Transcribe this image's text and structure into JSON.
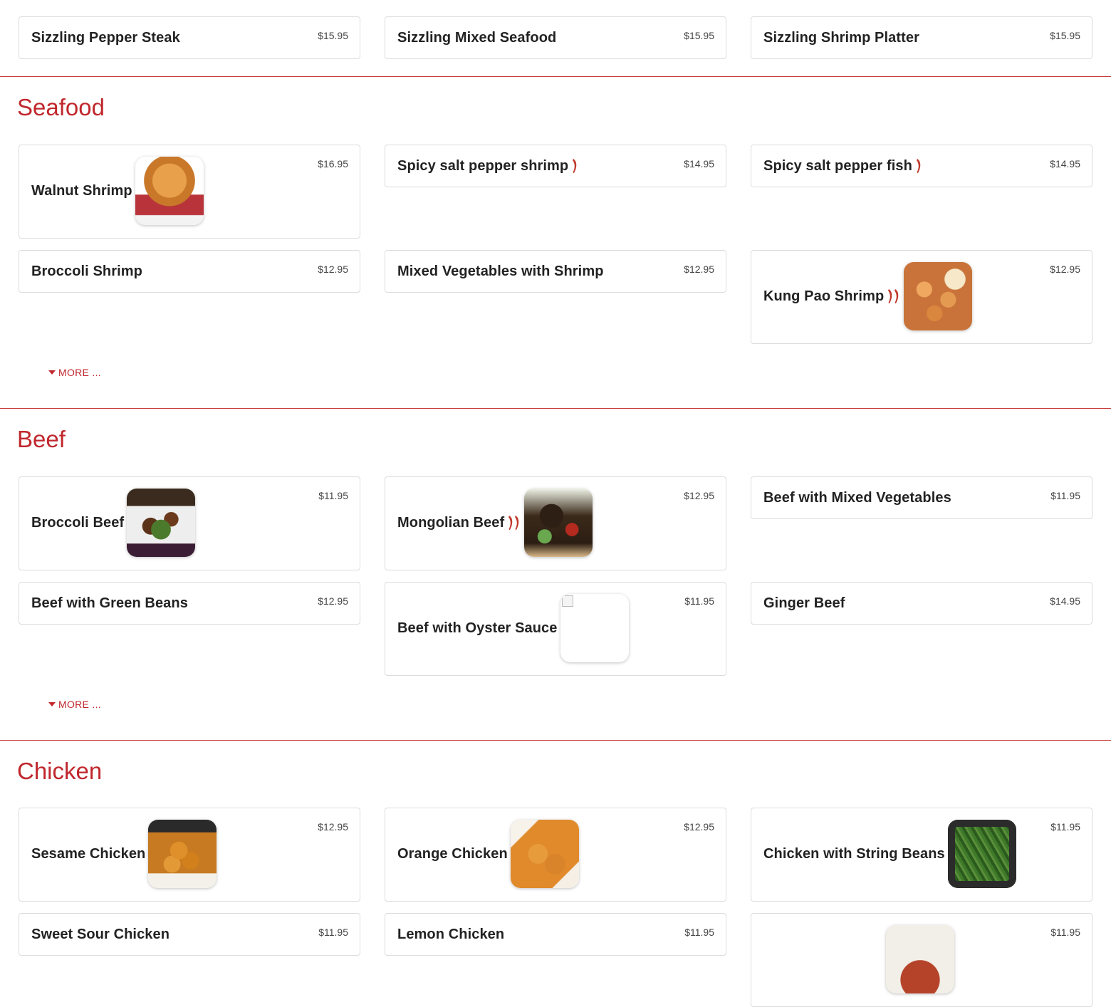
{
  "sections": {
    "sizzling": {
      "items": [
        {
          "name": "Sizzling Pepper Steak",
          "price": "$15.95"
        },
        {
          "name": "Sizzling Mixed Seafood",
          "price": "$15.95"
        },
        {
          "name": "Sizzling Shrimp Platter",
          "price": "$15.95"
        }
      ]
    },
    "seafood": {
      "title": "Seafood",
      "more_label": "MORE ...",
      "items": [
        {
          "name": "Walnut Shrimp",
          "price": "$16.95",
          "image": "walnut-shrimp-photo"
        },
        {
          "name": "Spicy salt pepper shrimp",
          "price": "$14.95",
          "spicy": 1
        },
        {
          "name": "Spicy salt pepper fish",
          "price": "$14.95",
          "spicy": 1
        },
        {
          "name": "Broccoli Shrimp",
          "price": "$12.95"
        },
        {
          "name": "Mixed Vegetables with Shrimp",
          "price": "$12.95"
        },
        {
          "name": "Kung Pao Shrimp",
          "price": "$12.95",
          "spicy": 2,
          "image": "kung-pao-shrimp-photo"
        }
      ]
    },
    "beef": {
      "title": "Beef",
      "more_label": "MORE ...",
      "items": [
        {
          "name": "Broccoli Beef",
          "price": "$11.95",
          "image": "broccoli-beef-photo"
        },
        {
          "name": "Mongolian Beef",
          "price": "$12.95",
          "spicy": 2,
          "image": "mongolian-beef-photo"
        },
        {
          "name": "Beef with Mixed Vegetables",
          "price": "$11.95"
        },
        {
          "name": "Beef with Green Beans",
          "price": "$12.95"
        },
        {
          "name": "Beef with Oyster Sauce",
          "price": "$11.95",
          "image": "broken-image"
        },
        {
          "name": "Ginger Beef",
          "price": "$14.95"
        }
      ]
    },
    "chicken": {
      "title": "Chicken",
      "items": [
        {
          "name": "Sesame Chicken",
          "price": "$12.95",
          "image": "sesame-chicken-photo"
        },
        {
          "name": "Orange Chicken",
          "price": "$12.95",
          "image": "orange-chicken-photo"
        },
        {
          "name": "Chicken with String Beans",
          "price": "$11.95",
          "image": "string-beans-photo"
        },
        {
          "name": "Sweet Sour Chicken",
          "price": "$11.95"
        },
        {
          "name": "Lemon Chicken",
          "price": "$11.95"
        },
        {
          "name": "",
          "price": "$11.95",
          "image": "chicken-dish-photo"
        }
      ]
    }
  },
  "colors": {
    "accent": "#c0272d",
    "divider": "#c83a3a",
    "chili": "#c0392b"
  }
}
